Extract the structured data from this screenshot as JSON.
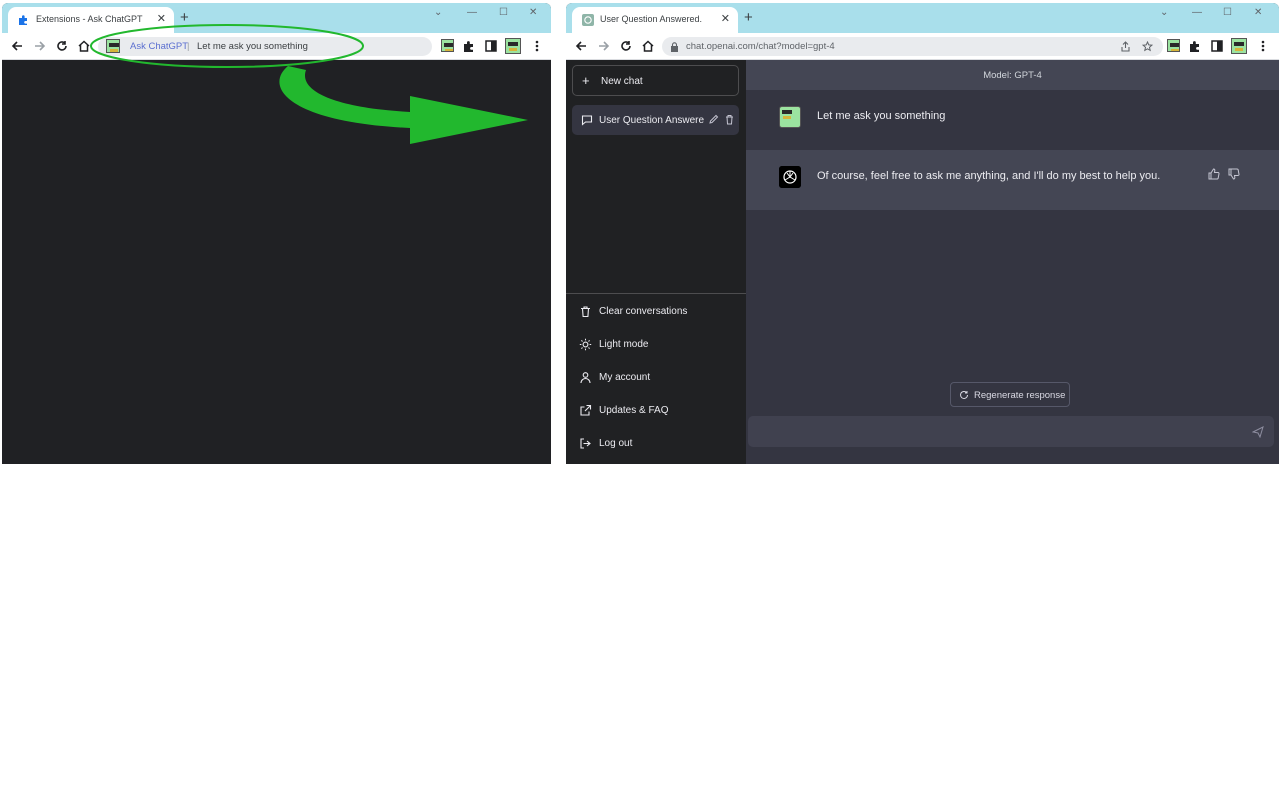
{
  "left_window": {
    "tab_title": "Extensions - Ask ChatGPT",
    "omnibox_keyword": "Ask ChatGPT",
    "omnibox_query": "Let me ask you something"
  },
  "right_window": {
    "tab_title": "User Question Answered.",
    "url": "chat.openai.com/chat?model=gpt-4",
    "sidebar": {
      "new_chat": "New chat",
      "conversation": "User Question Answere",
      "items": [
        {
          "label": "Clear conversations",
          "icon": "trash-icon"
        },
        {
          "label": "Light mode",
          "icon": "sun-icon"
        },
        {
          "label": "My account",
          "icon": "user-icon"
        },
        {
          "label": "Updates & FAQ",
          "icon": "external-link-icon"
        },
        {
          "label": "Log out",
          "icon": "logout-icon"
        }
      ]
    },
    "model_label": "Model: GPT-4",
    "messages": [
      {
        "role": "user",
        "text": "Let me ask you something"
      },
      {
        "role": "assistant",
        "text": "Of course, feel free to ask me anything, and I'll do my best to help you."
      }
    ],
    "regenerate": "Regenerate response"
  },
  "colors": {
    "tabstrip": "#a9dfeb",
    "annotation_green": "#22b82e",
    "sidebar": "#202123",
    "chat_bg": "#343541",
    "assistant_bg": "#444654"
  }
}
